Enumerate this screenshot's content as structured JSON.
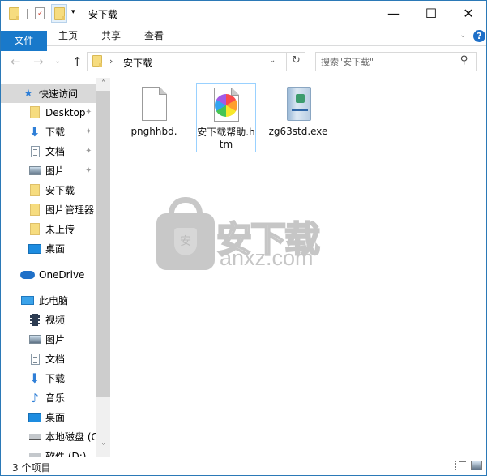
{
  "window": {
    "title": "安下载",
    "controls": {
      "minimize": "—",
      "maximize": "☐",
      "close": "✕"
    }
  },
  "quick_access_toolbar": {
    "items": [
      "folder-icon",
      "properties-icon",
      "new-folder-icon",
      "customize-dropdown"
    ]
  },
  "ribbon": {
    "tabs": [
      {
        "label": "文件",
        "active": true
      },
      {
        "label": "主页"
      },
      {
        "label": "共享"
      },
      {
        "label": "查看"
      }
    ],
    "expand_glyph": "⌄",
    "help_glyph": "?"
  },
  "navigation": {
    "back": "←",
    "forward": "→",
    "recent": "⌄",
    "up": "↑",
    "address": {
      "crumb_separator": "›",
      "path": "安下载",
      "dropdown_glyph": "⌄",
      "refresh_glyph": "↻"
    },
    "search": {
      "placeholder": "搜索\"安下载\"",
      "value": "",
      "icon": "⚲"
    }
  },
  "nav_pane": {
    "quick_access_label": "快速访问",
    "items": [
      {
        "label": "Desktop",
        "icon": "folder",
        "pinned": true
      },
      {
        "label": "下载",
        "icon": "download",
        "pinned": true
      },
      {
        "label": "文档",
        "icon": "document",
        "pinned": true
      },
      {
        "label": "图片",
        "icon": "pictures",
        "pinned": true
      },
      {
        "label": "安下载",
        "icon": "folder"
      },
      {
        "label": "图片管理器",
        "icon": "folder"
      },
      {
        "label": "未上传",
        "icon": "folder"
      },
      {
        "label": "桌面",
        "icon": "desktop"
      }
    ],
    "onedrive_label": "OneDrive",
    "this_pc_label": "此电脑",
    "pc_items": [
      {
        "label": "视频",
        "icon": "video"
      },
      {
        "label": "图片",
        "icon": "pictures"
      },
      {
        "label": "文档",
        "icon": "document"
      },
      {
        "label": "下载",
        "icon": "download"
      },
      {
        "label": "音乐",
        "icon": "music"
      },
      {
        "label": "桌面",
        "icon": "desktop"
      },
      {
        "label": "本地磁盘 (C",
        "icon": "disk"
      },
      {
        "label": "软件 (D:)",
        "icon": "disk"
      }
    ],
    "pin_glyph": "📌",
    "scroll_up": "˄",
    "scroll_down": "˅"
  },
  "files": [
    {
      "name": "pnghhbd.",
      "type": "blank"
    },
    {
      "name": "安下载帮助.htm",
      "type": "htm",
      "selected": true
    },
    {
      "name": "zg63std.exe",
      "type": "exe"
    }
  ],
  "watermark": {
    "cn": "安下载",
    "en": "anxz.com",
    "shield_char": "安"
  },
  "status": {
    "item_count": "3 个项目"
  }
}
